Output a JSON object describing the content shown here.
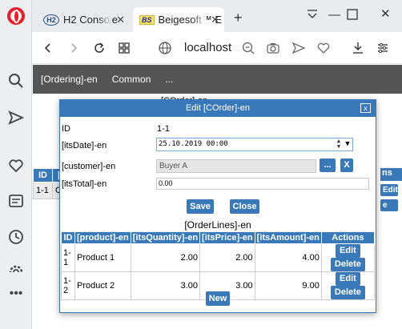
{
  "tabs": [
    {
      "favicon": "H2",
      "label": "H2 Console"
    },
    {
      "favicon": "BS",
      "label": "Beigesoft™ E"
    }
  ],
  "addressbar": {
    "url": "localhost"
  },
  "menu": {
    "items": [
      "[Ordering]-en",
      "Common",
      "..."
    ]
  },
  "underlying": {
    "header_fragment": "[COrder]-en",
    "headers": [
      "ID",
      "[its"
    ],
    "row": {
      "id": "1-1",
      "text": "C"
    },
    "right_header": "ns",
    "right_buttons": [
      "Edit",
      "e"
    ]
  },
  "dialog": {
    "title": "Edit [COrder]-en",
    "close_label": "x",
    "fields": {
      "id_label": "ID",
      "id_value": "1-1",
      "date_label": "[itsDate]-en",
      "date_value": "25.10.2019 00:00",
      "customer_label": "[customer]-en",
      "customer_value": "Buyer A",
      "customer_pick_label": "...",
      "customer_clear_label": "X",
      "total_label": "[itsTotal]-en",
      "total_value": "0.00"
    },
    "save_label": "Save",
    "close_button_label": "Close",
    "lines_title": "[OrderLines]-en",
    "lines_columns": [
      "ID",
      "[product]-en",
      "[itsQuantity]-en",
      "[itsPrice]-en",
      "[itsAmount]-en",
      "Actions"
    ],
    "lines_rows": [
      {
        "id": "1-1",
        "product": "Product 1",
        "quantity": "2.00",
        "price": "2.00",
        "amount": "4.00"
      },
      {
        "id": "1-2",
        "product": "Product 2",
        "quantity": "3.00",
        "price": "3.00",
        "amount": "9.00"
      }
    ],
    "edit_label": "Edit",
    "delete_label": "Delete",
    "new_label": "New"
  },
  "colors": {
    "accent": "#3a79b9",
    "menu_bg": "#555555",
    "opera_red": "#e3202b"
  }
}
